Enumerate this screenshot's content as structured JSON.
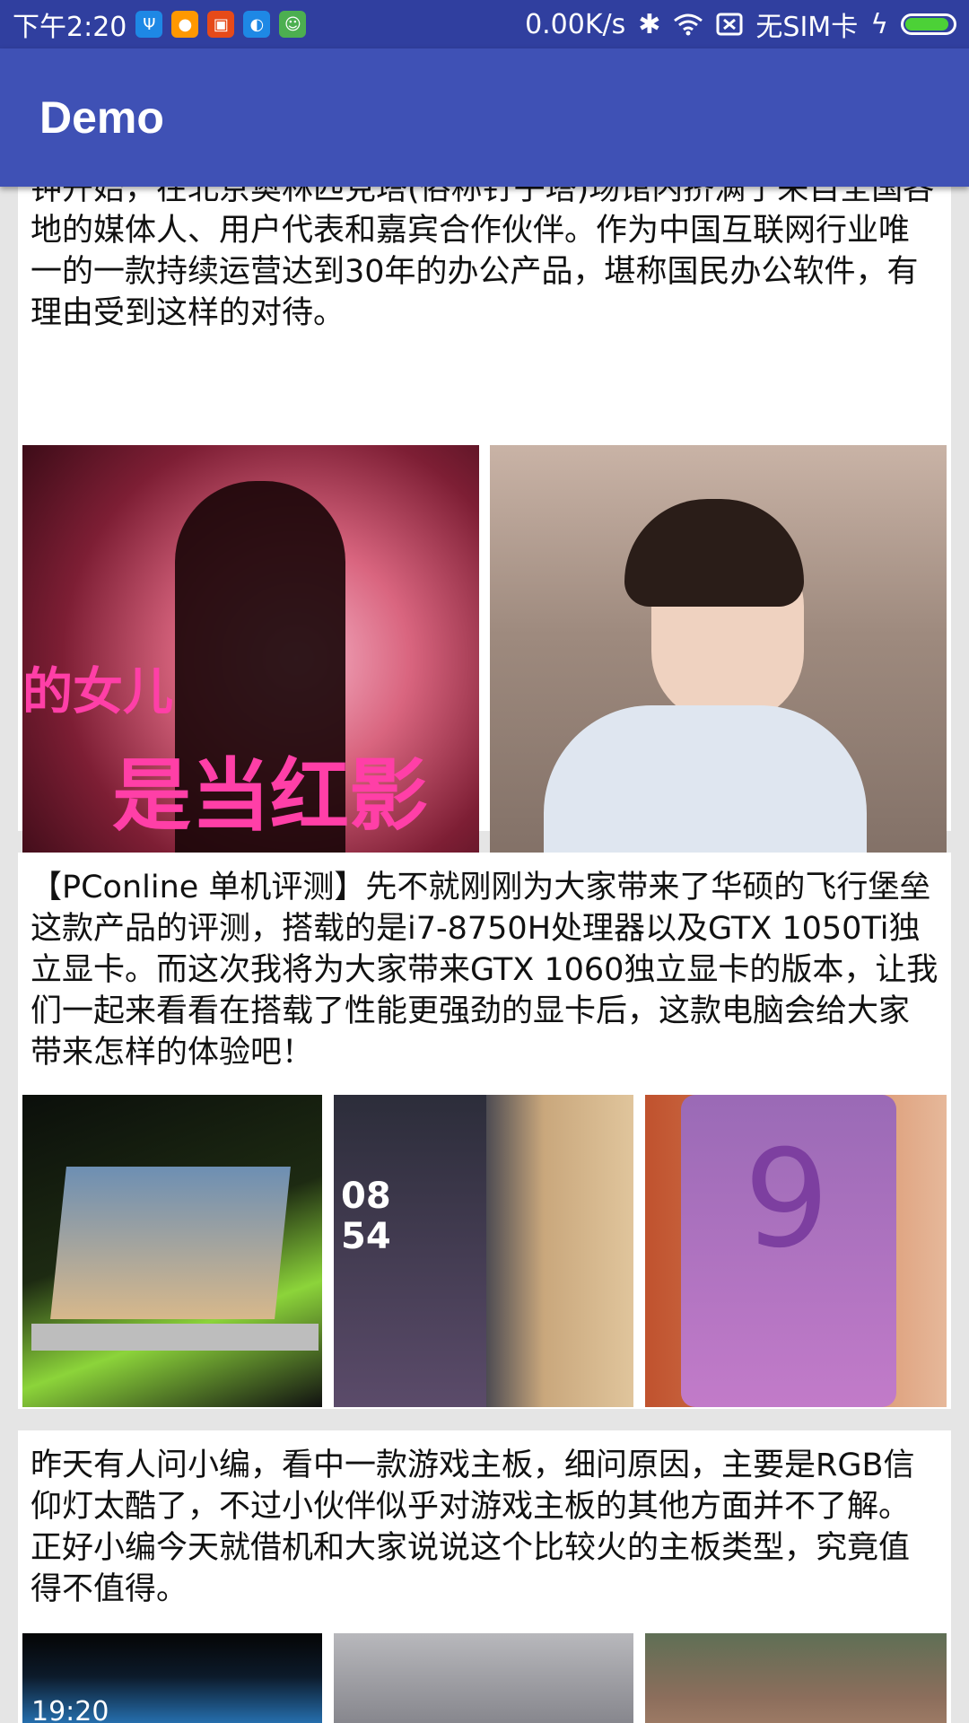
{
  "status_bar": {
    "time": "下午2:20",
    "net_speed": "0.00K/s",
    "carrier": "无SIM卡",
    "icons": [
      "usb-icon",
      "app-icon-orange",
      "app-icon-sohu",
      "app-icon-blue",
      "android-icon",
      "bluetooth-icon",
      "wifi-icon",
      "no-sim-icon",
      "charging-icon",
      "battery-icon"
    ]
  },
  "app_bar": {
    "title": "Demo"
  },
  "cards": [
    {
      "text": "钟开始，在北京奥林匹克塔(俗称钉子塔)场馆内挤满了来自全国各地的媒体人、用户代表和嘉宾合作伙伴。作为中国互联网行业唯一的一款持续运营达到30年的办公产品，堪称国民办公软件，有理由受到这样的对待。",
      "images": [
        {
          "name": "news-image-silhouette",
          "overlay_line1": "的女儿",
          "overlay_line2": "是当红影"
        },
        {
          "name": "news-image-actress"
        }
      ]
    },
    {
      "text": "【PConline 单机评测】先不就刚刚为大家带来了华硕的飞行堡垒这款产品的评测，搭载的是i7-8750H处理器以及GTX 1050Ti独立显卡。而这次我将为大家带来GTX 1060独立显卡的版本，让我们一起来看看在搭载了性能更强劲的显卡后，这款电脑会给大家带来怎样的体验吧！",
      "images": [
        {
          "name": "news-image-laptop"
        },
        {
          "name": "news-image-phone-edge",
          "overlay_line1": "08",
          "overlay_line2": "54"
        },
        {
          "name": "news-image-galaxy-note",
          "overlay_line1": "9"
        }
      ]
    },
    {
      "text": "昨天有人问小编，看中一款游戏主板，细问原因，主要是RGB信仰灯太酷了，不过小伙伴似乎对游戏主板的其他方面并不了解。正好小编今天就借机和大家说说这个比较火的主板类型，究竟值得不值得。",
      "images": [
        {
          "name": "news-image-phone-blue",
          "overlay_line1": "19:20"
        },
        {
          "name": "news-image-street-gray"
        },
        {
          "name": "news-image-building"
        }
      ]
    }
  ],
  "colors": {
    "status_bar": "#303F9F",
    "app_bar": "#3F51B5",
    "background": "#E5E5E5",
    "card": "#FFFFFF"
  }
}
